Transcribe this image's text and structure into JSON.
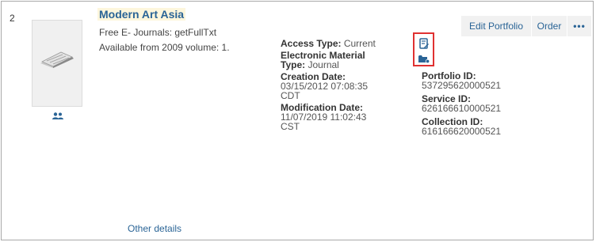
{
  "result": {
    "index": "2",
    "title": "Modern Art Asia",
    "line1": "Free E- Journals: getFullTxt",
    "line2": "Available from 2009 volume: 1.",
    "access_type_label": "Access Type:",
    "access_type_value": "Current",
    "material_type_label_a": "Electronic Material",
    "material_type_label_b": "Type:",
    "material_type_value": "Journal",
    "creation_date_label": "Creation Date:",
    "creation_date_value_a": "03/15/2012 07:08:35",
    "creation_date_value_b": "CDT",
    "modification_date_label": "Modification Date:",
    "modification_date_value_a": "11/07/2019 11:02:43",
    "modification_date_value_b": "CST",
    "portfolio_id_label": "Portfolio ID:",
    "portfolio_id_value": "537295620000521",
    "service_id_label": "Service ID:",
    "service_id_value": "626166610000521",
    "collection_id_label": "Collection ID:",
    "collection_id_value": "616166620000521",
    "other_details": "Other details"
  },
  "actions": {
    "edit_portfolio": "Edit Portfolio",
    "order": "Order",
    "more": "•••"
  },
  "icons": {
    "thumbnail": "journal-thumbnail-icon",
    "group": "group-icon",
    "edit_record": "edit-document-icon",
    "folder": "folder-icon"
  },
  "colors": {
    "link": "#2a6496",
    "highlight_box": "#e03131",
    "button_bg": "#f1f1f1",
    "title_bg": "#fdf6dc"
  }
}
